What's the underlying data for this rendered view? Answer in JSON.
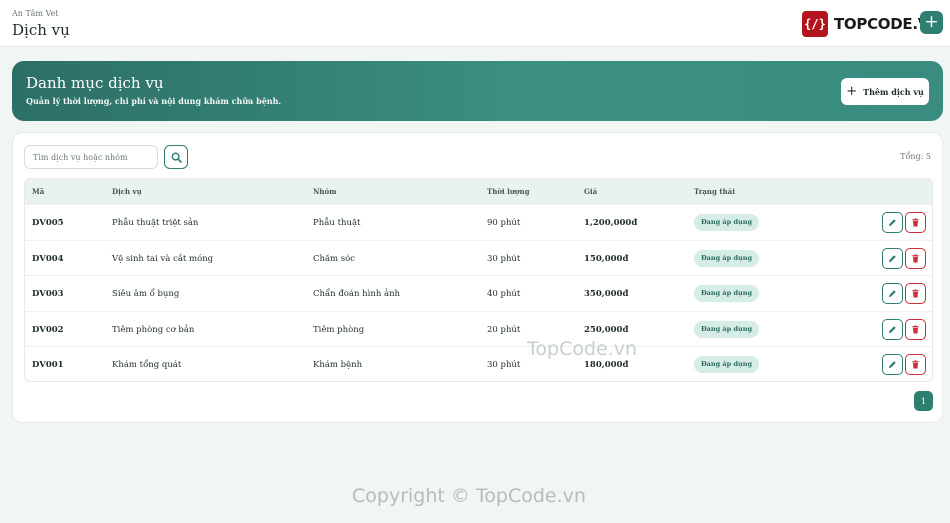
{
  "header": {
    "breadcrumb": "An Tâm Vet",
    "title": "Dịch vụ",
    "logo_text": "TOPCODE.VN",
    "logo_mark": "{/}",
    "add_icon": "plus-icon"
  },
  "hero": {
    "title": "Danh mục dịch vụ",
    "subtitle": "Quản lý thời lượng, chi phí và nội dung khám chữa bệnh.",
    "button_label": "Thêm dịch vụ"
  },
  "toolbar": {
    "search_placeholder": "Tìm dịch vụ hoặc nhóm",
    "search_icon": "search-icon",
    "total": "Tổng: 5"
  },
  "table": {
    "columns": [
      "Mã",
      "Dịch vụ",
      "Nhóm",
      "Thời lượng",
      "Giá",
      "Trạng thái"
    ],
    "rows": [
      {
        "code": "DV005",
        "name": "Phẫu thuật triệt sản",
        "group": "Phẫu thuật",
        "duration": "90 phút",
        "price": "1,200,000đ",
        "status": "Đang áp dụng"
      },
      {
        "code": "DV004",
        "name": "Vệ sinh tai và cắt móng",
        "group": "Chăm sóc",
        "duration": "30 phút",
        "price": "150,000đ",
        "status": "Đang áp dụng"
      },
      {
        "code": "DV003",
        "name": "Siêu âm ổ bụng",
        "group": "Chẩn đoán hình ảnh",
        "duration": "40 phút",
        "price": "350,000đ",
        "status": "Đang áp dụng"
      },
      {
        "code": "DV002",
        "name": "Tiêm phòng cơ bản",
        "group": "Tiêm phòng",
        "duration": "20 phút",
        "price": "250,000đ",
        "status": "Đang áp dụng"
      },
      {
        "code": "DV001",
        "name": "Khám tổng quát",
        "group": "Khám bệnh",
        "duration": "30 phút",
        "price": "180,000đ",
        "status": "Đang áp dụng"
      }
    ]
  },
  "pagination": {
    "current": "1"
  },
  "watermarks": {
    "center": "TopCode.vn",
    "bottom": "Copyright © TopCode.vn"
  },
  "colors": {
    "brand": "#2f7e72",
    "danger": "#c9303a",
    "badge_bg": "#d6ece6",
    "logo_red": "#b3131d"
  }
}
